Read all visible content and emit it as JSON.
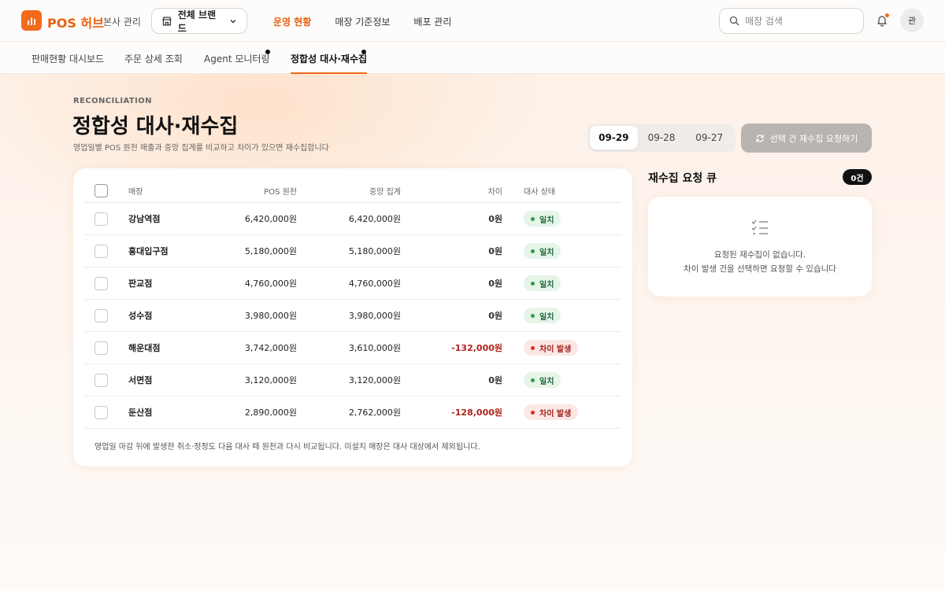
{
  "header": {
    "logo_text": "POS 허브",
    "hq_label": "본사 관리",
    "brand_select": "전체 브랜드",
    "nav": [
      {
        "label": "운영 현황",
        "active": true
      },
      {
        "label": "매장 기준정보",
        "active": false
      },
      {
        "label": "배포 관리",
        "active": false
      }
    ],
    "search_placeholder": "매장 검색",
    "avatar": "관"
  },
  "subnav": {
    "tabs": [
      {
        "label": "판매현황 대시보드"
      },
      {
        "label": "주문 상세 조회"
      },
      {
        "label": "Agent 모니터링"
      },
      {
        "label": "정합성 대사·재수집"
      }
    ]
  },
  "page": {
    "eyebrow": "RECONCILIATION",
    "title": "정합성 대사·재수집",
    "subtitle": "영업일별 POS 원천 매출과 중앙 집계를 비교하고 차이가 있으면 재수집합니다",
    "dates": [
      "09-29",
      "09-28",
      "09-27"
    ],
    "selected_date": "09-29",
    "recollect_button": "선택 건 재수집 요청하기"
  },
  "table": {
    "columns": {
      "store": "매장",
      "pos": "POS 원천",
      "central": "중앙 집계",
      "diff": "차이",
      "status": "대사 상태"
    },
    "rows": [
      {
        "store": "강남역점",
        "pos": "6,420,000원",
        "central": "6,420,000원",
        "diff": "0원",
        "status": "일치"
      },
      {
        "store": "홍대입구점",
        "pos": "5,180,000원",
        "central": "5,180,000원",
        "diff": "0원",
        "status": "일치"
      },
      {
        "store": "판교점",
        "pos": "4,760,000원",
        "central": "4,760,000원",
        "diff": "0원",
        "status": "일치"
      },
      {
        "store": "성수점",
        "pos": "3,980,000원",
        "central": "3,980,000원",
        "diff": "0원",
        "status": "일치"
      },
      {
        "store": "해운대점",
        "pos": "3,742,000원",
        "central": "3,610,000원",
        "diff": "-132,000원",
        "status": "차이 발생"
      },
      {
        "store": "서면점",
        "pos": "3,120,000원",
        "central": "3,120,000원",
        "diff": "0원",
        "status": "일치"
      },
      {
        "store": "둔산점",
        "pos": "2,890,000원",
        "central": "2,762,000원",
        "diff": "-128,000원",
        "status": "차이 발생"
      }
    ],
    "footnote": "영업일 마감 뒤에 발생한 취소·정정도 다음 대사 때 원천과 다시 비교됩니다. 미설치 매장은 대사 대상에서 제외됩니다."
  },
  "queue": {
    "title": "재수집 요청 큐",
    "count": "0건",
    "empty_line1": "요청된 재수집이 없습니다.",
    "empty_line2": "차이 발생 건을 선택하면 요청할 수 있습니다"
  },
  "colors": {
    "accent": "#f26a1b",
    "ok": "#1e6b34",
    "ng": "#a32019"
  }
}
